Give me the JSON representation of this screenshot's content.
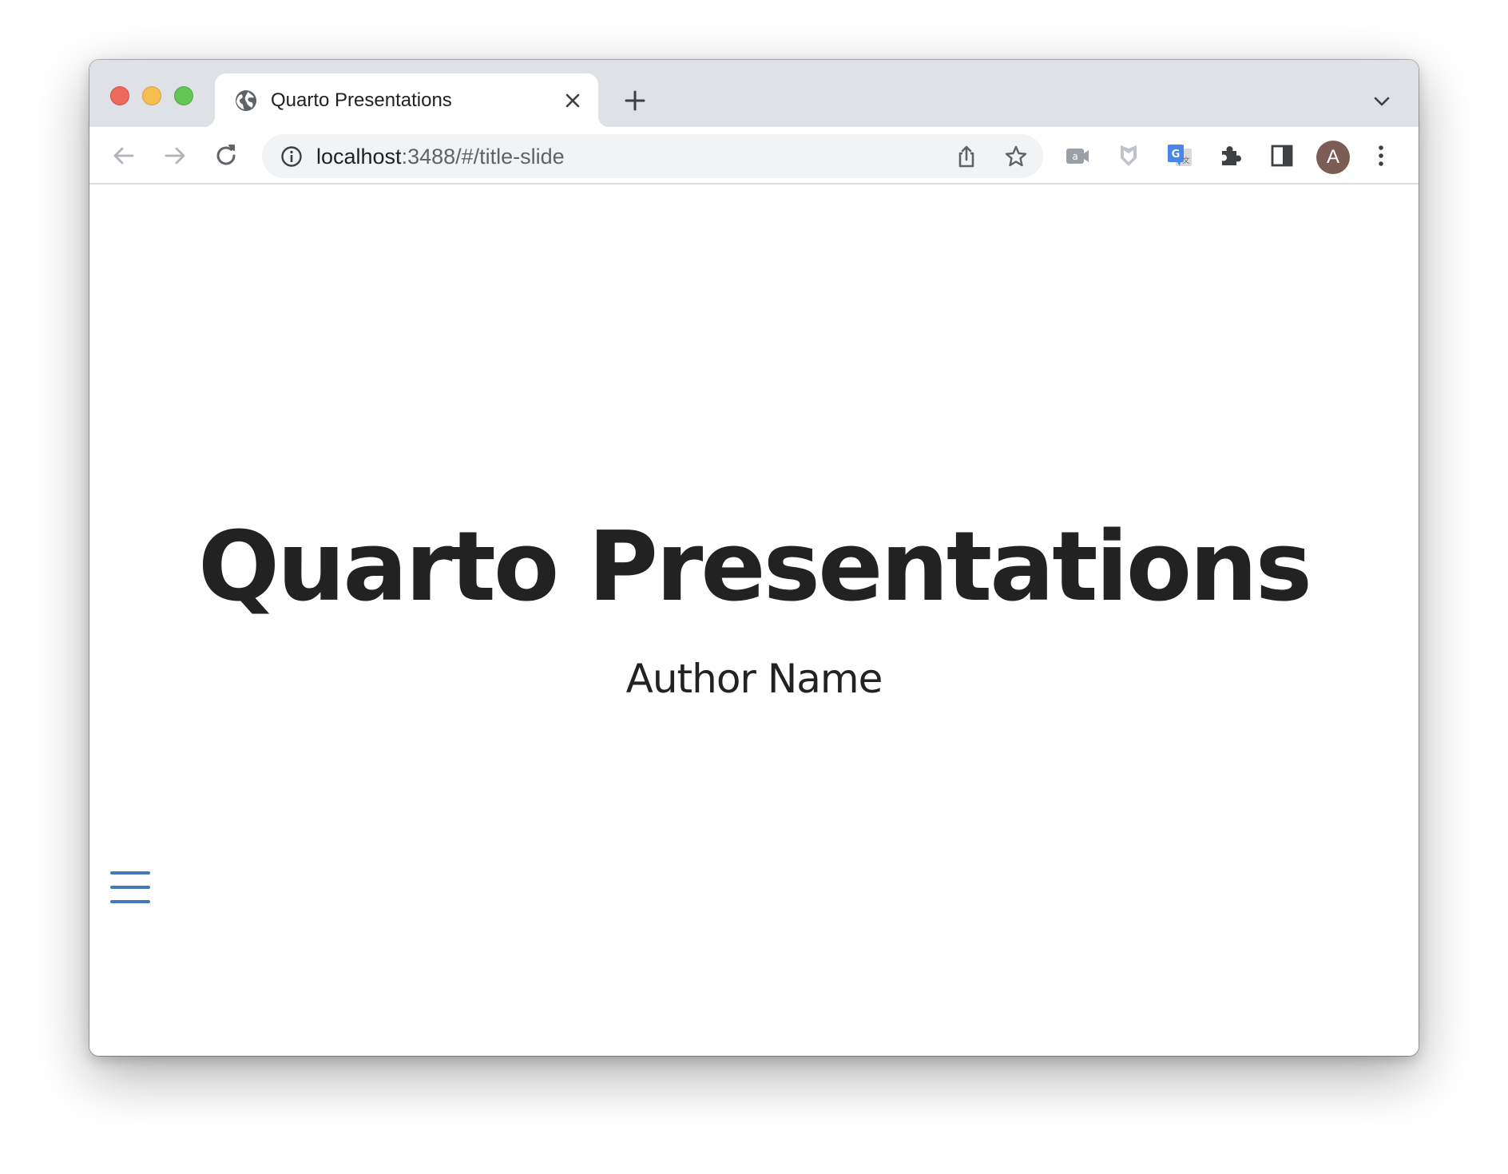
{
  "browser": {
    "tab": {
      "title": "Quarto Presentations",
      "favicon": "globe-icon"
    },
    "new_tab_icon": "plus-icon",
    "tab_search_icon": "chevron-down-icon",
    "nav": {
      "back_icon": "arrow-left-icon",
      "forward_icon": "arrow-right-icon",
      "reload_icon": "reload-icon"
    },
    "address": {
      "host": "localhost",
      "rest": ":3488/#/title-slide",
      "info_icon": "info-icon"
    },
    "extensions": [
      "camera-extension-icon",
      "shield-extension-icon",
      "translate-extension-icon",
      "puzzle-icon",
      "side-panel-icon"
    ],
    "profile_initial": "A",
    "menu_icon": "kebab-menu-icon"
  },
  "slide": {
    "title": "Quarto Presentations",
    "author": "Author Name",
    "menu_icon": "hamburger-menu-icon",
    "menu_color": "#447abc"
  },
  "colors": {
    "tabstrip": "#dee1e6",
    "omnibox": "#f1f3f4",
    "text": "#222222",
    "avatar": "#7b5d56"
  }
}
